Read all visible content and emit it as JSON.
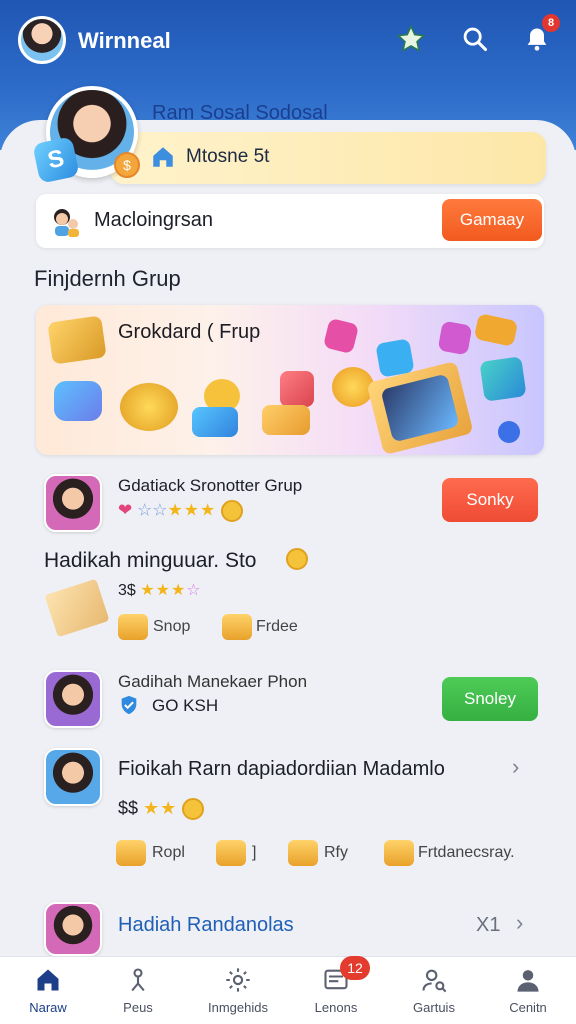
{
  "header": {
    "title": "Wirnneal",
    "notification_badge": "8",
    "icons": [
      "star-icon",
      "search-icon",
      "bell-icon"
    ]
  },
  "profile": {
    "name": "Ram Sosal Sodosal",
    "subtitle": "Mtosne 5t"
  },
  "promo_row": {
    "text": "Macloingrsan",
    "button": "Gamaay"
  },
  "section_title": "Finjdernh Grup",
  "featured": {
    "title": "Grokdard ( Frup"
  },
  "cards": [
    {
      "title": "Gdatiack Sronotter Grup",
      "button": "Sonky",
      "line2": "Hadikah minguuar. Sto",
      "line3": "3$",
      "items": [
        "Snop",
        "Frdee"
      ]
    },
    {
      "title": "Gadihah Manekaer Phon",
      "status": "GO KSH",
      "button": "Snoley"
    },
    {
      "title": "Fioikah Rarn dapiadordiian Madamlo",
      "price": "$$",
      "items": [
        "Ropl",
        "]",
        "Rfy",
        "Frtdanecsray."
      ]
    },
    {
      "title": "Hadiah Randanolas",
      "count": "X1"
    }
  ],
  "bottom_nav": {
    "items": [
      {
        "label": "Naraw",
        "icon": "home-icon"
      },
      {
        "label": "Peus",
        "icon": "person-pin-icon"
      },
      {
        "label": "Inmgehids",
        "icon": "gear-icon"
      },
      {
        "label": "Lenons",
        "icon": "message-icon",
        "badge": "12"
      },
      {
        "label": "Gartuis",
        "icon": "user-search-icon"
      },
      {
        "label": "Cenitn",
        "icon": "profile-icon"
      }
    ]
  },
  "colors": {
    "header_blue": "#2056b4",
    "accent_orange": "#f25a1f",
    "accent_green": "#35b042",
    "title_blue": "#1b3f8f"
  }
}
